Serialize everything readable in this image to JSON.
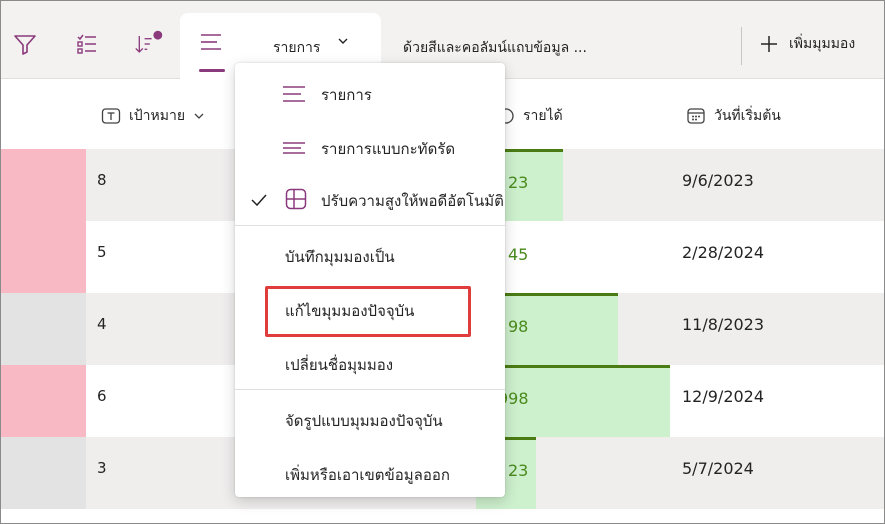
{
  "toolbar": {
    "icons": [
      "filter-icon",
      "list-checklist-icon",
      "sort-icon"
    ],
    "sort_indicator_color": "#8a3a7c",
    "active_view_label": "รายการ",
    "view_link": "ด้วยสีและคอลัมน์แถบข้อมูล ...",
    "add_view_label": "เพิ่มมุมมอง"
  },
  "columns": {
    "target": "เป้าหมาย",
    "revenue": "รายได้",
    "start_date": "วันที่เริ่มต้น"
  },
  "rows": [
    {
      "target": "8",
      "revenue": "23",
      "date": "9/6/2023",
      "swatch": "#f8b8c4",
      "revenue_fill": 0.45,
      "shaded": true
    },
    {
      "target": "5",
      "revenue": "45",
      "date": "2/28/2024",
      "swatch": "#f8b8c4",
      "revenue_fill": 0.0,
      "shaded": false
    },
    {
      "target": "4",
      "revenue": "98",
      "date": "11/8/2023",
      "swatch": "#e3e3e3",
      "revenue_fill": 0.73,
      "shaded": true
    },
    {
      "target": "6",
      "revenue": "998",
      "date": "12/9/2024",
      "swatch": "#f8b8c4",
      "revenue_fill": 1.0,
      "shaded": false
    },
    {
      "target": "3",
      "revenue": "23",
      "date": "5/7/2024",
      "swatch": "#e3e3e3",
      "revenue_fill": 0.31,
      "shaded": true
    }
  ],
  "menu": {
    "items": [
      {
        "label": "รายการ",
        "icon": "list-lines-icon"
      },
      {
        "label": "รายการแบบกะทัดรัด",
        "icon": "compact-list-icon"
      },
      {
        "label": "ปรับความสูงให้พอดีอัตโนมัติ",
        "icon": "table-autofit-icon",
        "checked": true
      },
      {
        "label": "บันทึกมุมมองเป็น"
      },
      {
        "label": "แก้ไขมุมมองปัจจุบัน",
        "highlighted": true
      },
      {
        "label": "เปลี่ยนชื่อมุมมอง"
      },
      {
        "label": "จัดรูปแบบมุมมองปัจจุบัน"
      },
      {
        "label": "เพิ่มหรือเอาเขตข้อมูลออก"
      }
    ]
  },
  "colors": {
    "accent": "#8a3a7c",
    "revenue_bar": "#cdf0cd",
    "revenue_text": "#4a8a1c",
    "highlight": "#e03c3c"
  }
}
